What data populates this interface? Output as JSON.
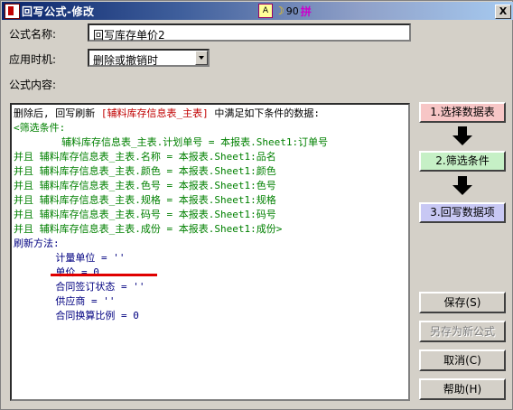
{
  "window": {
    "title": "回写公式-修改",
    "close_glyph": "X"
  },
  "ime": {
    "icon1": "A",
    "icon3": "90",
    "icon4": "拼"
  },
  "form": {
    "name_label": "公式名称:",
    "name_value": "回写库存单价2",
    "timing_label": "应用时机:",
    "timing_value": "删除或撤销时",
    "content_label": "公式内容:"
  },
  "editor": {
    "l1_a": "删除后, 回写刷新 ",
    "l1_b": "[辅料库存信息表_主表]",
    "l1_c": " 中满足如下条件的数据:",
    "l2": "<筛选条件:",
    "l3": "        辅料库存信息表_主表.计划单号 = 本报表.Sheet1:订单号",
    "l4": "并且 辅料库存信息表_主表.名称 = 本报表.Sheet1:品名",
    "l5": "并且 辅料库存信息表_主表.颜色 = 本报表.Sheet1:颜色",
    "l6": "并且 辅料库存信息表_主表.色号 = 本报表.Sheet1:色号",
    "l7": "并且 辅料库存信息表_主表.规格 = 本报表.Sheet1:规格",
    "l8": "并且 辅料库存信息表_主表.码号 = 本报表.Sheet1:码号",
    "l9": "并且 辅料库存信息表_主表.成份 = 本报表.Sheet1:成份>",
    "l10": "刷新方法:",
    "l11": "       计量单位 = ''",
    "l12": "       单价 = 0",
    "l13": "       合同签订状态 = ''",
    "l14": "       供应商 = ''",
    "l15": "       合同换算比例 = 0"
  },
  "steps": {
    "step1": "1.选择数据表",
    "step2": "2.筛选条件",
    "step3": "3.回写数据项"
  },
  "buttons": {
    "save": "保存(S)",
    "save_as": "另存为新公式",
    "cancel": "取消(C)",
    "help": "帮助(H)"
  }
}
